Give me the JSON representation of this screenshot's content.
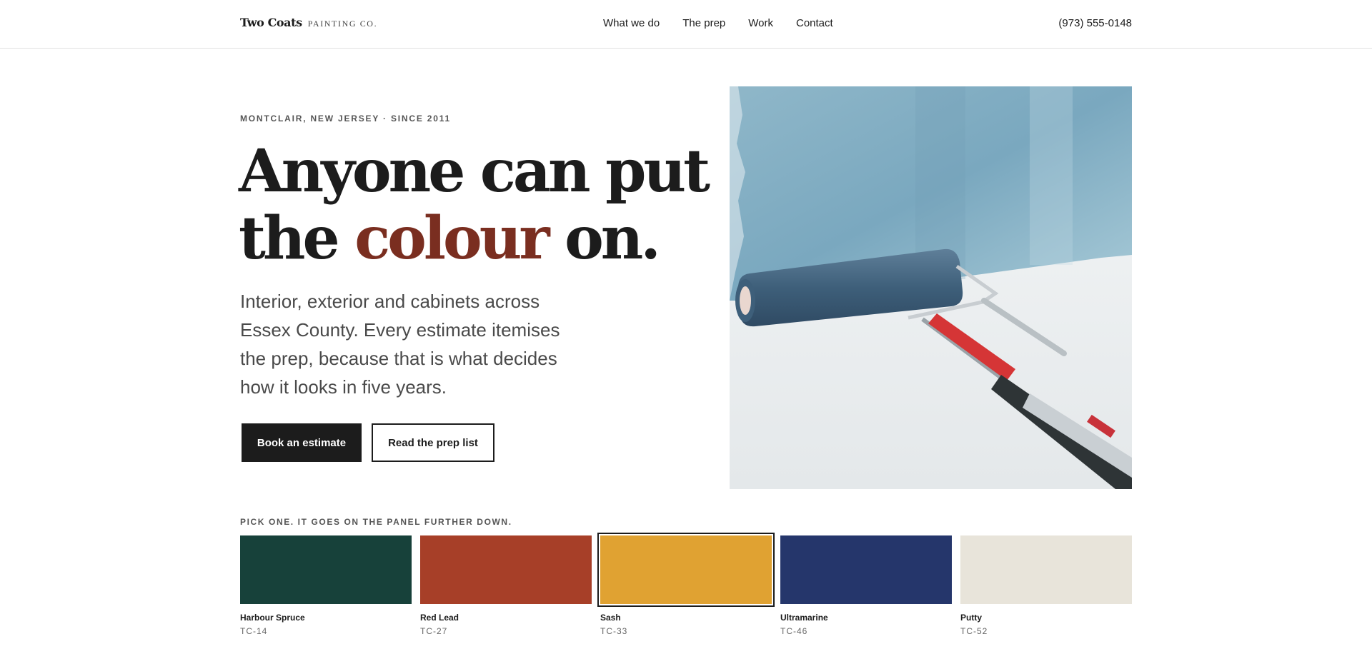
{
  "header": {
    "logo_main": "Two Coats",
    "logo_sub": "PAINTING CO.",
    "nav": [
      "What we do",
      "The prep",
      "Work",
      "Contact"
    ],
    "phone": "(973) 555-0148"
  },
  "hero": {
    "eyebrow": "MONTCLAIR, NEW JERSEY · SINCE 2011",
    "headline_line1": "Anyone can put",
    "headline_the": "the",
    "headline_accent": "colour",
    "headline_end": "on.",
    "lede": "Interior, exterior and cabinets across Essex County. Every estimate itemises the prep, because that is what decides how it looks in five years.",
    "primary_button": "Book an estimate",
    "secondary_button": "Read the prep list",
    "image": "paint-roller-photo"
  },
  "picker": {
    "label": "PICK ONE. IT GOES ON THE PANEL FURTHER DOWN.",
    "selected": "Sash",
    "swatches": [
      {
        "name": "Harbour Spruce",
        "code": "TC-14",
        "color": "#17413a"
      },
      {
        "name": "Red Lead",
        "code": "TC-27",
        "color": "#a73f28"
      },
      {
        "name": "Sash",
        "code": "TC-33",
        "color": "#e0a232"
      },
      {
        "name": "Ultramarine",
        "code": "TC-46",
        "color": "#25366b"
      },
      {
        "name": "Putty",
        "code": "TC-52",
        "color": "#e8e4da"
      }
    ]
  },
  "colors": {
    "accent": "#7a2e20",
    "ink": "#1c1c1c"
  }
}
